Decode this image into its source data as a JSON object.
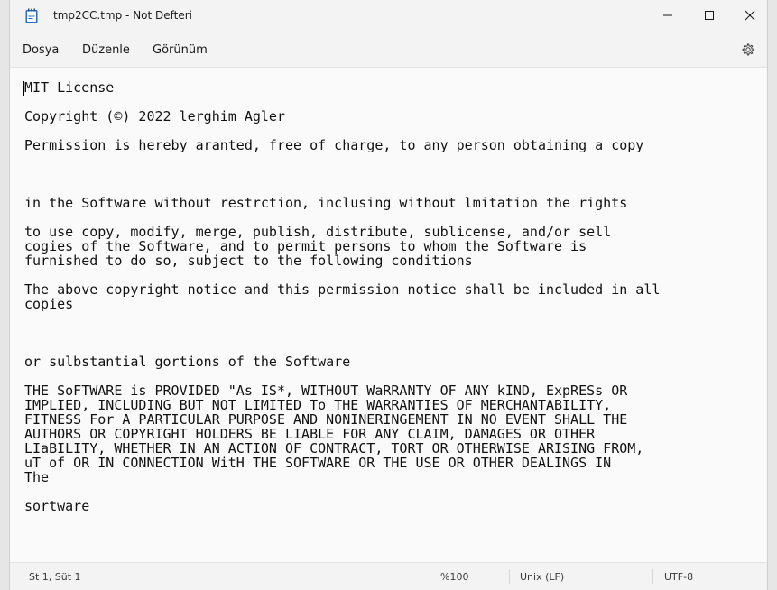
{
  "window": {
    "title": "tmp2CC.tmp - Not Defteri",
    "controls": {
      "minimize": "minimize-icon",
      "maximize": "maximize-icon",
      "close": "close-icon"
    }
  },
  "menu": {
    "file": "Dosya",
    "edit": "Düzenle",
    "view": "Görünüm",
    "settings_icon": "gear-icon"
  },
  "editor": {
    "text": "MIT License\n\nCopyright (©) 2022 lerghim Agler\n\nPermission is hereby aranted, free of charge, to any person obtaining a copy\n\n\n\nin the Software without restrction, inclusing without lmitation the rights\n\nto use copy, modify, merge, publish, distribute, sublicense, and/or sell\ncogies of the Software, and to permit persons to whom the Software is\nfurnished to do so, subject to the following conditions\n\nThe above copyright notice and this permission notice shall be included in all\ncopies\n\n\n\nor sulbstantial gortions of the Software\n\nTHE SoFTWARE is PROVIDED \"As IS*, WITHOUT WaRRANTY OF ANY kIND, ExpRESs OR\nIMPLIED, INCLUDING BUT NOT LIMITED To THE WARRANTIES OF MERCHANTABILITY,\nFITNESS For A PARTICULAR PURPOSE AND NONINERINGEMENT IN NO EVENT SHALL THE\nAUTHORS OR COPYRIGHT HOLDERS BE LIABLE FOR ANY CLAIM, DAMAGES OR OTHER\nLIaBILITY, WHETHER IN AN ACTION OF CONTRACT, TORT OR OTHERWISE ARISING FROM,\nuT of OR IN CONNECTION WitH THE SOFTWARE OR THE USE OR OTHER DEALINGS IN\nThe\n\nsortware"
  },
  "status": {
    "position": "St 1, Süt 1",
    "zoom": "%100",
    "line_ending": "Unix (LF)",
    "encoding": "UTF-8"
  },
  "colors": {
    "chrome_bg": "#f3f3f3",
    "editor_bg": "#fafafa",
    "app_icon_blue": "#2b6cc4"
  }
}
